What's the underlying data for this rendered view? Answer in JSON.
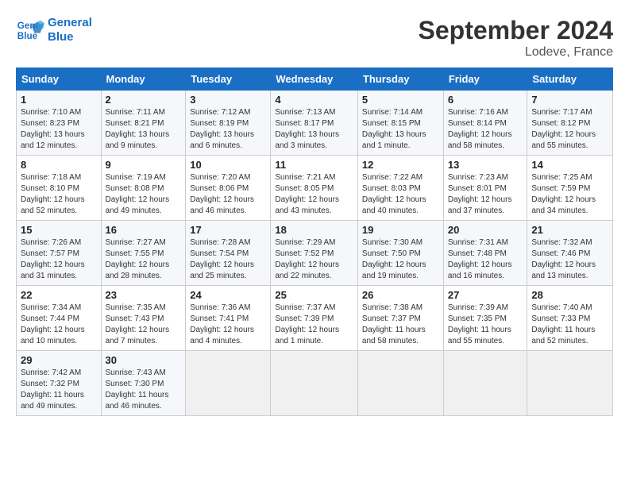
{
  "header": {
    "logo_line1": "General",
    "logo_line2": "Blue",
    "month": "September 2024",
    "location": "Lodeve, France"
  },
  "columns": [
    "Sunday",
    "Monday",
    "Tuesday",
    "Wednesday",
    "Thursday",
    "Friday",
    "Saturday"
  ],
  "weeks": [
    [
      {
        "day": "1",
        "info": "Sunrise: 7:10 AM\nSunset: 8:23 PM\nDaylight: 13 hours\nand 12 minutes."
      },
      {
        "day": "2",
        "info": "Sunrise: 7:11 AM\nSunset: 8:21 PM\nDaylight: 13 hours\nand 9 minutes."
      },
      {
        "day": "3",
        "info": "Sunrise: 7:12 AM\nSunset: 8:19 PM\nDaylight: 13 hours\nand 6 minutes."
      },
      {
        "day": "4",
        "info": "Sunrise: 7:13 AM\nSunset: 8:17 PM\nDaylight: 13 hours\nand 3 minutes."
      },
      {
        "day": "5",
        "info": "Sunrise: 7:14 AM\nSunset: 8:15 PM\nDaylight: 13 hours\nand 1 minute."
      },
      {
        "day": "6",
        "info": "Sunrise: 7:16 AM\nSunset: 8:14 PM\nDaylight: 12 hours\nand 58 minutes."
      },
      {
        "day": "7",
        "info": "Sunrise: 7:17 AM\nSunset: 8:12 PM\nDaylight: 12 hours\nand 55 minutes."
      }
    ],
    [
      {
        "day": "8",
        "info": "Sunrise: 7:18 AM\nSunset: 8:10 PM\nDaylight: 12 hours\nand 52 minutes."
      },
      {
        "day": "9",
        "info": "Sunrise: 7:19 AM\nSunset: 8:08 PM\nDaylight: 12 hours\nand 49 minutes."
      },
      {
        "day": "10",
        "info": "Sunrise: 7:20 AM\nSunset: 8:06 PM\nDaylight: 12 hours\nand 46 minutes."
      },
      {
        "day": "11",
        "info": "Sunrise: 7:21 AM\nSunset: 8:05 PM\nDaylight: 12 hours\nand 43 minutes."
      },
      {
        "day": "12",
        "info": "Sunrise: 7:22 AM\nSunset: 8:03 PM\nDaylight: 12 hours\nand 40 minutes."
      },
      {
        "day": "13",
        "info": "Sunrise: 7:23 AM\nSunset: 8:01 PM\nDaylight: 12 hours\nand 37 minutes."
      },
      {
        "day": "14",
        "info": "Sunrise: 7:25 AM\nSunset: 7:59 PM\nDaylight: 12 hours\nand 34 minutes."
      }
    ],
    [
      {
        "day": "15",
        "info": "Sunrise: 7:26 AM\nSunset: 7:57 PM\nDaylight: 12 hours\nand 31 minutes."
      },
      {
        "day": "16",
        "info": "Sunrise: 7:27 AM\nSunset: 7:55 PM\nDaylight: 12 hours\nand 28 minutes."
      },
      {
        "day": "17",
        "info": "Sunrise: 7:28 AM\nSunset: 7:54 PM\nDaylight: 12 hours\nand 25 minutes."
      },
      {
        "day": "18",
        "info": "Sunrise: 7:29 AM\nSunset: 7:52 PM\nDaylight: 12 hours\nand 22 minutes."
      },
      {
        "day": "19",
        "info": "Sunrise: 7:30 AM\nSunset: 7:50 PM\nDaylight: 12 hours\nand 19 minutes."
      },
      {
        "day": "20",
        "info": "Sunrise: 7:31 AM\nSunset: 7:48 PM\nDaylight: 12 hours\nand 16 minutes."
      },
      {
        "day": "21",
        "info": "Sunrise: 7:32 AM\nSunset: 7:46 PM\nDaylight: 12 hours\nand 13 minutes."
      }
    ],
    [
      {
        "day": "22",
        "info": "Sunrise: 7:34 AM\nSunset: 7:44 PM\nDaylight: 12 hours\nand 10 minutes."
      },
      {
        "day": "23",
        "info": "Sunrise: 7:35 AM\nSunset: 7:43 PM\nDaylight: 12 hours\nand 7 minutes."
      },
      {
        "day": "24",
        "info": "Sunrise: 7:36 AM\nSunset: 7:41 PM\nDaylight: 12 hours\nand 4 minutes."
      },
      {
        "day": "25",
        "info": "Sunrise: 7:37 AM\nSunset: 7:39 PM\nDaylight: 12 hours\nand 1 minute."
      },
      {
        "day": "26",
        "info": "Sunrise: 7:38 AM\nSunset: 7:37 PM\nDaylight: 11 hours\nand 58 minutes."
      },
      {
        "day": "27",
        "info": "Sunrise: 7:39 AM\nSunset: 7:35 PM\nDaylight: 11 hours\nand 55 minutes."
      },
      {
        "day": "28",
        "info": "Sunrise: 7:40 AM\nSunset: 7:33 PM\nDaylight: 11 hours\nand 52 minutes."
      }
    ],
    [
      {
        "day": "29",
        "info": "Sunrise: 7:42 AM\nSunset: 7:32 PM\nDaylight: 11 hours\nand 49 minutes."
      },
      {
        "day": "30",
        "info": "Sunrise: 7:43 AM\nSunset: 7:30 PM\nDaylight: 11 hours\nand 46 minutes."
      },
      {
        "day": "",
        "info": ""
      },
      {
        "day": "",
        "info": ""
      },
      {
        "day": "",
        "info": ""
      },
      {
        "day": "",
        "info": ""
      },
      {
        "day": "",
        "info": ""
      }
    ]
  ]
}
